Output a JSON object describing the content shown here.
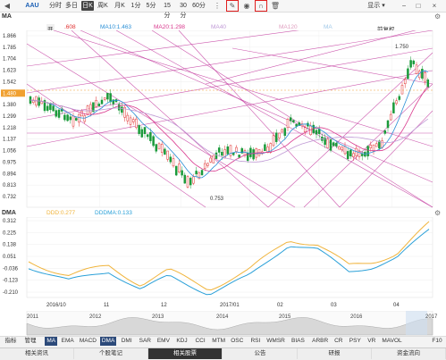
{
  "toolbar": {
    "symbol": "AAU",
    "periods": [
      "分时",
      "多日",
      "日K",
      "周K",
      "月K",
      "1分",
      "5分",
      "15分",
      "30分",
      "60分"
    ],
    "active_period": "日K",
    "display_label": "显示 ▾",
    "window_controls": [
      "−",
      "□",
      "×"
    ]
  },
  "main_chart": {
    "indicator_name": "MA",
    "price_label": "开",
    "price_value": ".608",
    "ma10_label": "MA10:1.463",
    "ma20_label": "MA20:1.298",
    "ma40_label": "MA40",
    "ma120_label": "MA120",
    "ma_other_label": "MA",
    "adjust_label": "前复权",
    "y_ticks": [
      "1.866",
      "1.785",
      "1.704",
      "1.623",
      "1.542",
      "1.480",
      "1.380",
      "1.299",
      "1.218",
      "1.137",
      "1.056",
      "0.975",
      "0.894",
      "0.813",
      "0.732"
    ],
    "current_price_tag": "1.480",
    "high_annotation": "1.750",
    "low_annotation": "0.753"
  },
  "sub_chart": {
    "indicator_name": "DMA",
    "ddd_label": "DDD:0.277",
    "ddma_label": "DDDMA:0.133",
    "y_ticks": [
      "0.312",
      "0.225",
      "0.138",
      "0.051",
      "-0.036",
      "-0.123",
      "-0.210"
    ]
  },
  "x_axis": {
    "labels": [
      "2016/10",
      "11",
      "12",
      "2017/01",
      "02",
      "03",
      "04"
    ]
  },
  "overview": {
    "year_labels": [
      "2011",
      "2012",
      "2013",
      "2014",
      "2015",
      "2016",
      "2017"
    ]
  },
  "indicator_bar": {
    "prefix": "指标",
    "manage": "管理",
    "items": [
      "MA",
      "EMA",
      "MACD",
      "DMA",
      "DMI",
      "SAR",
      "EMV",
      "KDJ",
      "CCI",
      "MTM",
      "OSC",
      "RSI",
      "WMSR",
      "BIAS",
      "ARBR",
      "CR",
      "PSY",
      "VR",
      "MAVOL"
    ],
    "active": [
      "MA",
      "DMA"
    ],
    "f10": "F10"
  },
  "bottom_tabs": {
    "items": [
      "相关资讯",
      "个股笔记",
      "相关股票",
      "公告",
      "研报",
      "资金流向"
    ],
    "active": "相关股票"
  },
  "colors": {
    "up": "#e03030",
    "down": "#1a9a3a",
    "ma10": "#2a8fd6",
    "ma20": "#d93a8e",
    "ddd": "#f0b43c",
    "ddma": "#2aa0d8",
    "trendline": "#c0309a"
  }
}
